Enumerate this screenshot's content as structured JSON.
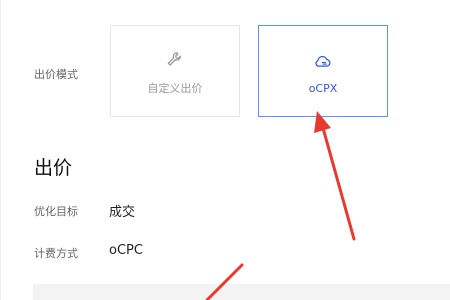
{
  "form": {
    "bid_mode_label": "出价模式",
    "bid_modes": [
      {
        "label": "自定义出价",
        "icon": "wrench-icon",
        "selected": false
      },
      {
        "label": "oCPX",
        "icon": "cloud-icon",
        "selected": true
      }
    ],
    "section_title": "出价",
    "opt_goal_label": "优化目标",
    "opt_goal_value": "成交",
    "billing_label": "计费方式",
    "billing_value": "oCPC"
  },
  "colors": {
    "accent": "#5b8ff9",
    "annotation_arrow": "#e8392e"
  }
}
